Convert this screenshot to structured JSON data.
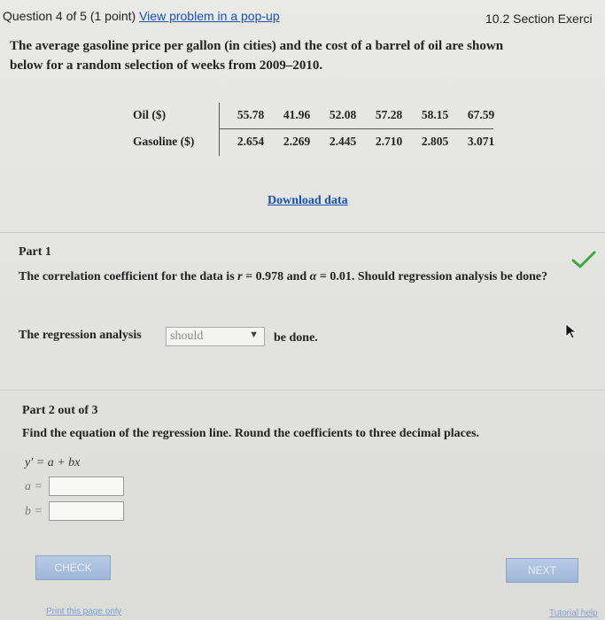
{
  "header": {
    "question_label": "Question 4 of 5 (1 point)",
    "popup_link": "View problem in a pop-up",
    "section": "10.2 Section Exerci"
  },
  "intro": "The average gasoline price per gallon (in cities) and the cost of a barrel of oil are shown below for a random selection of weeks from 2009–2010.",
  "table": {
    "rows": [
      {
        "label": "Oil ($)",
        "values": [
          "55.78",
          "41.96",
          "52.08",
          "57.28",
          "58.15",
          "67.59"
        ]
      },
      {
        "label": "Gasoline ($)",
        "values": [
          "2.654",
          "2.269",
          "2.445",
          "2.710",
          "2.805",
          "3.071"
        ]
      }
    ]
  },
  "download_link": "Download data",
  "part1": {
    "label": "Part 1",
    "q_a": "The correlation coefficient for the data is",
    "r_sym": "r",
    "q_b": "= 0.978 and",
    "alpha_sym": "α",
    "q_c": "= 0.01. Should regression analysis be done?",
    "answer_prefix": "The regression analysis",
    "dropdown_value": "should",
    "answer_suffix": "be done.",
    "status_color": "#3caa3c"
  },
  "part2": {
    "label": "Part 2 out of 3",
    "question": "Find the equation of the regression line. Round the coefficients to three decimal places.",
    "formula": "y′ = a + bx",
    "a_label": "a =",
    "b_label": "b =",
    "a_value": "",
    "b_value": ""
  },
  "buttons": {
    "check": "CHECK",
    "next": "NEXT"
  },
  "footer": {
    "print_link": "Print this page only",
    "help_link": "Tutorial help"
  },
  "colors": {
    "link": "#1a4fb5",
    "button": "#9db6d8"
  }
}
